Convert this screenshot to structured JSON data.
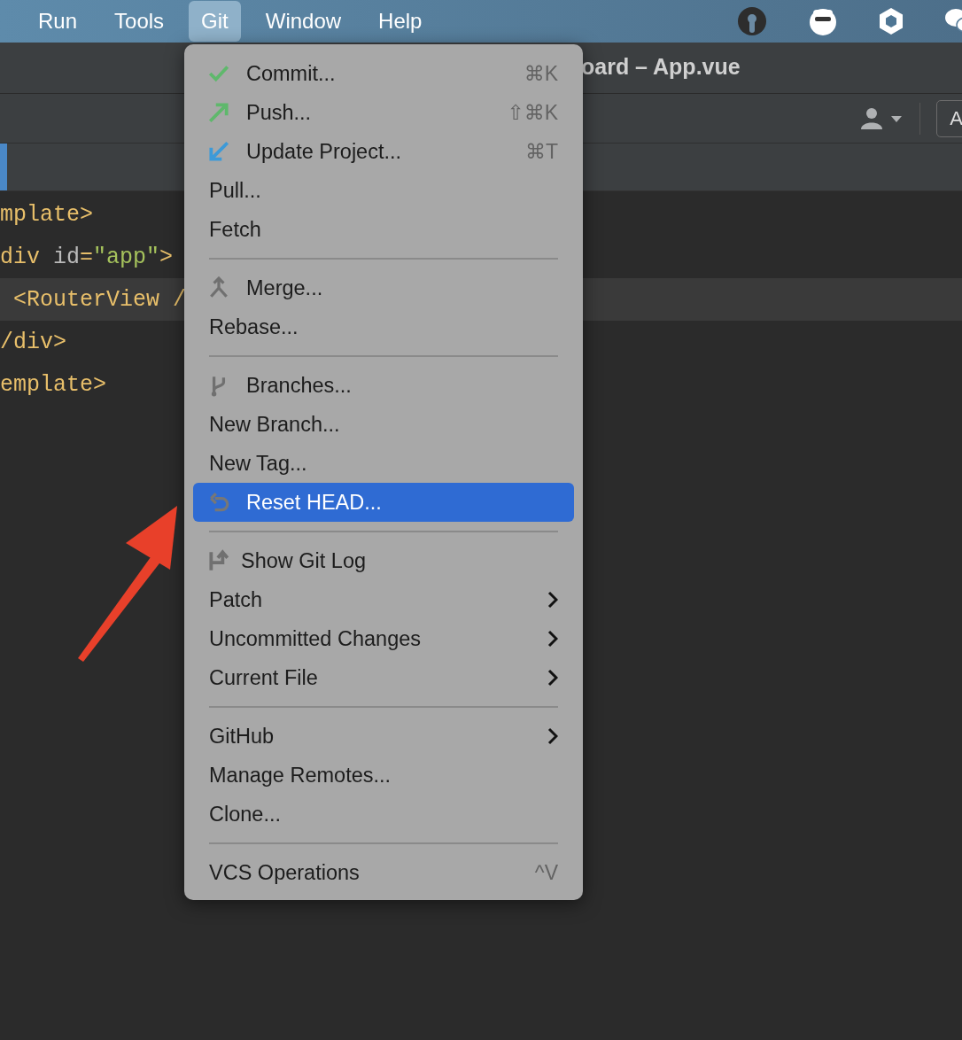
{
  "menu_bar": {
    "items": [
      {
        "label": "Run",
        "selected": false
      },
      {
        "label": "Tools",
        "selected": false
      },
      {
        "label": "Git",
        "selected": true
      },
      {
        "label": "Window",
        "selected": false
      },
      {
        "label": "Help",
        "selected": false
      }
    ]
  },
  "title_bar": {
    "title_right": "oard – App.vue"
  },
  "toolbar": {
    "button": "A"
  },
  "editor": {
    "lines": [
      {
        "highlighted": false,
        "tokens": [
          {
            "kind": "tag",
            "text": "mplate>"
          }
        ]
      },
      {
        "highlighted": false,
        "tokens": [
          {
            "kind": "tag",
            "text": "div"
          },
          {
            "kind": "attr",
            "text": " id"
          },
          {
            "kind": "tag",
            "text": "="
          },
          {
            "kind": "string",
            "text": "\"app\""
          },
          {
            "kind": "tag",
            "text": ">"
          }
        ]
      },
      {
        "highlighted": true,
        "tokens": [
          {
            "kind": "tag",
            "text": " <RouterView /"
          }
        ]
      },
      {
        "highlighted": false,
        "tokens": [
          {
            "kind": "tag",
            "text": "/div>"
          }
        ]
      },
      {
        "highlighted": false,
        "tokens": [
          {
            "kind": "tag",
            "text": "emplate>"
          }
        ]
      }
    ]
  },
  "git_menu": {
    "items": [
      {
        "kind": "item",
        "label": "Commit...",
        "shortcut": "⌘K",
        "selected": false
      },
      {
        "kind": "item",
        "label": "Push...",
        "shortcut": "⇧⌘K",
        "selected": false
      },
      {
        "kind": "item",
        "label": "Update Project...",
        "shortcut": "⌘T",
        "selected": false
      },
      {
        "kind": "item",
        "label": "Pull...",
        "selected": false
      },
      {
        "kind": "item",
        "label": "Fetch",
        "selected": false
      },
      {
        "kind": "separator"
      },
      {
        "kind": "item",
        "label": "Merge...",
        "selected": false
      },
      {
        "kind": "item",
        "label": "Rebase...",
        "selected": false
      },
      {
        "kind": "separator"
      },
      {
        "kind": "item",
        "label": "Branches...",
        "selected": false
      },
      {
        "kind": "item",
        "label": "New Branch...",
        "selected": false
      },
      {
        "kind": "item",
        "label": "New Tag...",
        "selected": false
      },
      {
        "kind": "item",
        "label": "Reset HEAD...",
        "selected": true
      },
      {
        "kind": "separator"
      },
      {
        "kind": "item",
        "label": "Show Git Log",
        "selected": false
      },
      {
        "kind": "item",
        "label": "Patch",
        "submenu": true,
        "selected": false
      },
      {
        "kind": "item",
        "label": "Uncommitted Changes",
        "submenu": true,
        "selected": false
      },
      {
        "kind": "item",
        "label": "Current File",
        "submenu": true,
        "selected": false
      },
      {
        "kind": "separator"
      },
      {
        "kind": "item",
        "label": "GitHub",
        "submenu": true,
        "selected": false
      },
      {
        "kind": "item",
        "label": "Manage Remotes...",
        "selected": false
      },
      {
        "kind": "item",
        "label": "Clone...",
        "selected": false
      },
      {
        "kind": "separator"
      },
      {
        "kind": "item",
        "label": "VCS Operations",
        "shortcut": "^V",
        "selected": false
      }
    ]
  }
}
